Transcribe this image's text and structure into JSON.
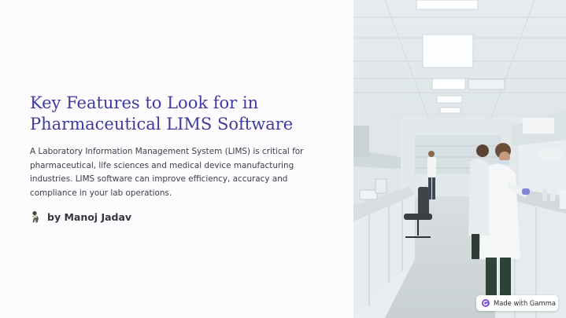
{
  "slide": {
    "title": "Key Features to Look for in Pharmaceutical LIMS Software",
    "description": "A Laboratory Information Management System (LIMS) is critical for pharmaceutical, life sciences and medical device manufacturing industries. LIMS software can improve efficiency, accuracy and compliance in your lab operations.",
    "author": "by Manoj Jadav",
    "avatar_icon": "person-avatar-icon",
    "hero_image": "laboratory-photo"
  },
  "badge": {
    "label": "Made with Gamma",
    "icon": "gamma-logo-icon"
  },
  "colors": {
    "title": "#3d3b9e",
    "body_text": "#3e3e46",
    "background": "#fdfbfd"
  }
}
